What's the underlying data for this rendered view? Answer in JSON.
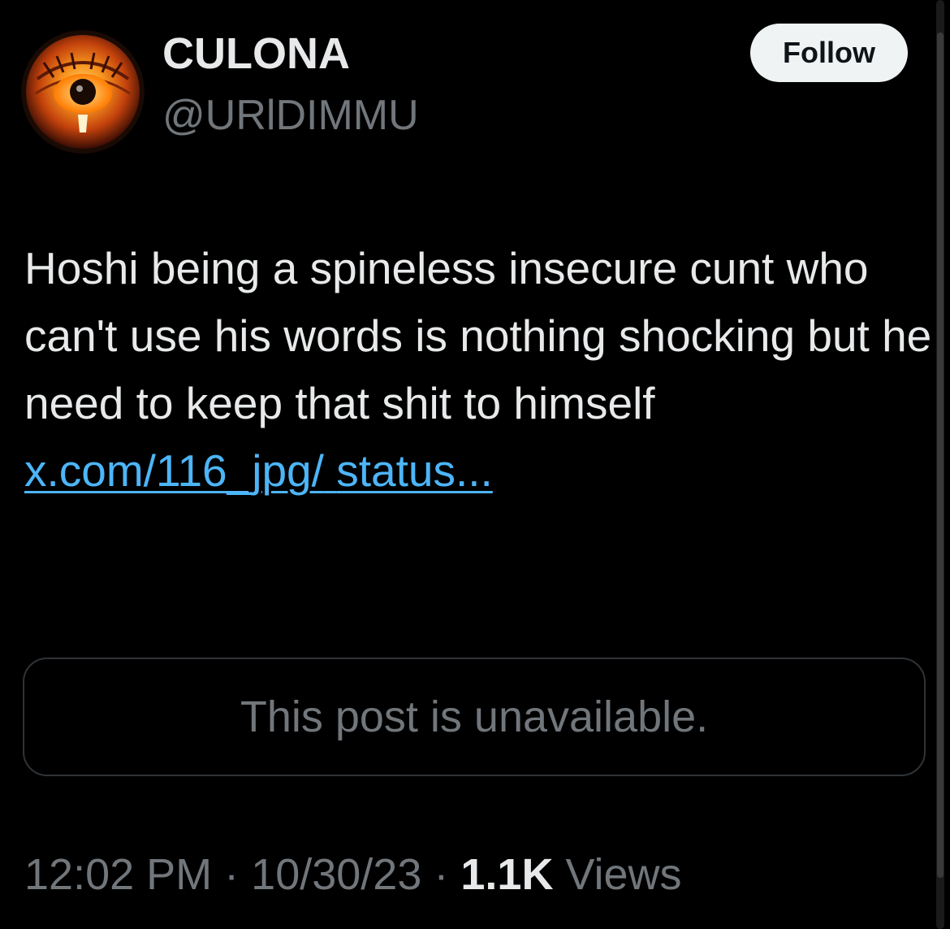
{
  "author": {
    "display_name": "CULONA",
    "handle": "@URlDIMMU",
    "avatar_icon": "orange-eye-avatar"
  },
  "follow_button": {
    "label": "Follow"
  },
  "tweet": {
    "text": "Hoshi being a spineless insecure cunt who can't use his words is nothing shocking but he need to keep that shit to himself ",
    "link_text_line1": "x.com/116_jpg/",
    "link_text_line2": "status..."
  },
  "quote": {
    "unavailable_text": "This post is unavailable."
  },
  "meta": {
    "time": "12:02 PM",
    "separator": "·",
    "date": "10/30/23",
    "views_count": "1.1K",
    "views_label": "Views"
  },
  "colors": {
    "background": "#000000",
    "text_primary": "#e7e9ea",
    "text_secondary": "#71767b",
    "link": "#4db5f7",
    "follow_bg": "#eff3f4",
    "border": "#2f3336"
  }
}
